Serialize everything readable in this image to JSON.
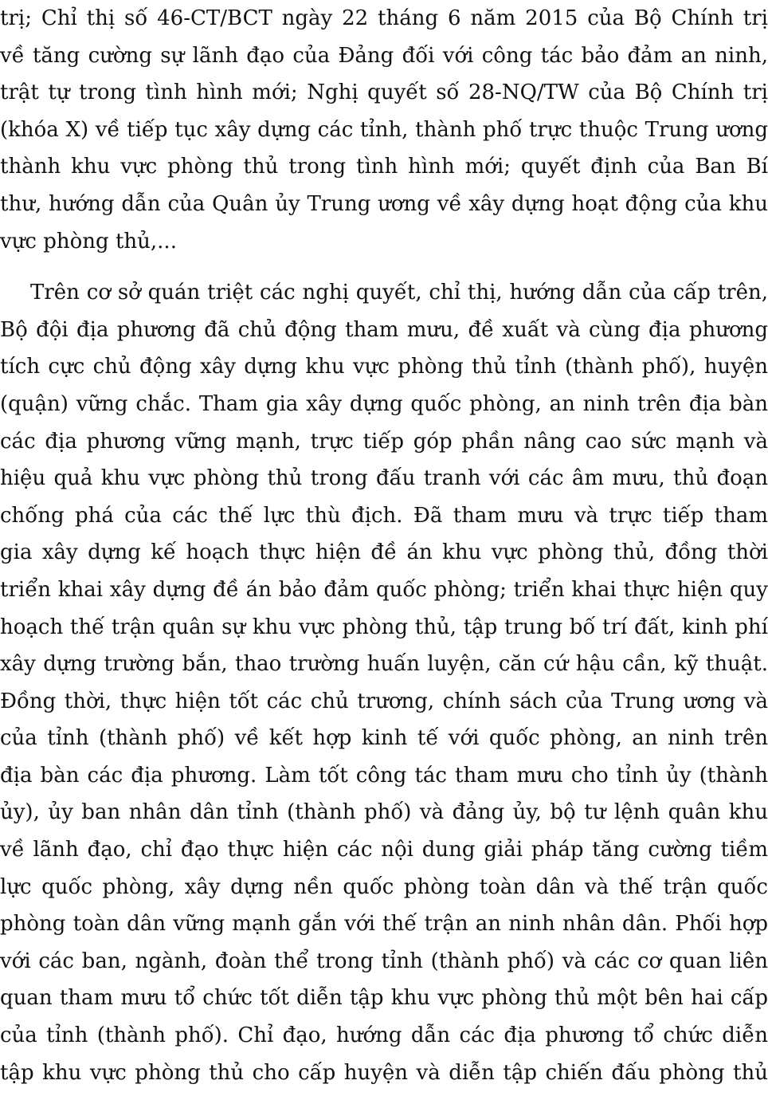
{
  "paragraphs": [
    {
      "lines": [
        "trị; Chỉ thị số 46-CT/BCT ngày 22 tháng 6 năm 2015 của Bộ Chính trị",
        "về tăng cường sự lãnh đạo của Đảng đối với công tác bảo đảm an ninh,",
        "trật tự trong tình hình mới; Nghị quyết số 28-NQ/TW của Bộ Chính trị",
        "(khóa X) về tiếp tục xây dựng các tỉnh, thành phố trực thuộc Trung ương",
        "thành khu vực phòng thủ trong tình hình mới; quyết định của Ban Bí",
        "thư, hướng dẫn của Quân ủy Trung ương về xây dựng hoạt động của khu",
        "vực phòng thủ,..."
      ]
    },
    {
      "lines": [
        "Trên cơ sở quán triệt các nghị quyết, chỉ thị, hướng dẫn của cấp trên,",
        "Bộ đội địa phương đã chủ động tham mưu, đề xuất và cùng địa phương",
        "tích cực chủ động xây dựng khu vực phòng thủ tỉnh (thành phố), huyện",
        "(quận) vững chắc. Tham gia xây dựng quốc phòng, an ninh trên địa bàn",
        "các địa phương vững mạnh, trực tiếp góp phần nâng cao sức mạnh và",
        "hiệu quả khu vực phòng thủ trong đấu tranh với các âm mưu, thủ đoạn",
        "chống phá của các thế lực thù địch. Đã tham mưu và trực tiếp tham",
        "gia xây dựng kế hoạch thực hiện đề án khu vực phòng thủ, đồng thời",
        "triển khai xây dựng đề án bảo đảm quốc phòng; triển khai thực hiện quy",
        "hoạch thế trận quân sự khu vực phòng thủ, tập trung bố trí đất, kinh phí",
        "xây dựng trường bắn, thao trường huấn luyện, căn cứ hậu cần, kỹ thuật.",
        "Đồng thời, thực hiện tốt các chủ trương, chính sách của Trung ương và",
        "của tỉnh (thành phố) về kết hợp kinh tế với quốc phòng, an ninh trên",
        "địa bàn các địa phương. Làm tốt công tác tham mưu cho tỉnh ủy (thành",
        "ủy), ủy ban nhân dân tỉnh (thành phố) và đảng ủy, bộ tư lệnh quân khu",
        "về lãnh đạo, chỉ đạo thực hiện các nội dung giải pháp tăng cường tiềm",
        "lực quốc phòng, xây dựng nền quốc phòng toàn dân và thế trận quốc",
        "phòng toàn dân vững mạnh gắn với thế trận an ninh nhân dân. Phối hợp",
        "với các ban, ngành, đoàn thể trong tỉnh (thành phố) và các cơ quan liên",
        "quan tham mưu tổ chức tốt diễn tập khu vực phòng thủ một bên hai cấp",
        "của tỉnh (thành phố). Chỉ đạo, hướng dẫn các địa phương tổ chức diễn",
        "tập khu vực phòng thủ cho cấp huyện và diễn tập chiến đấu phòng thủ"
      ]
    }
  ]
}
